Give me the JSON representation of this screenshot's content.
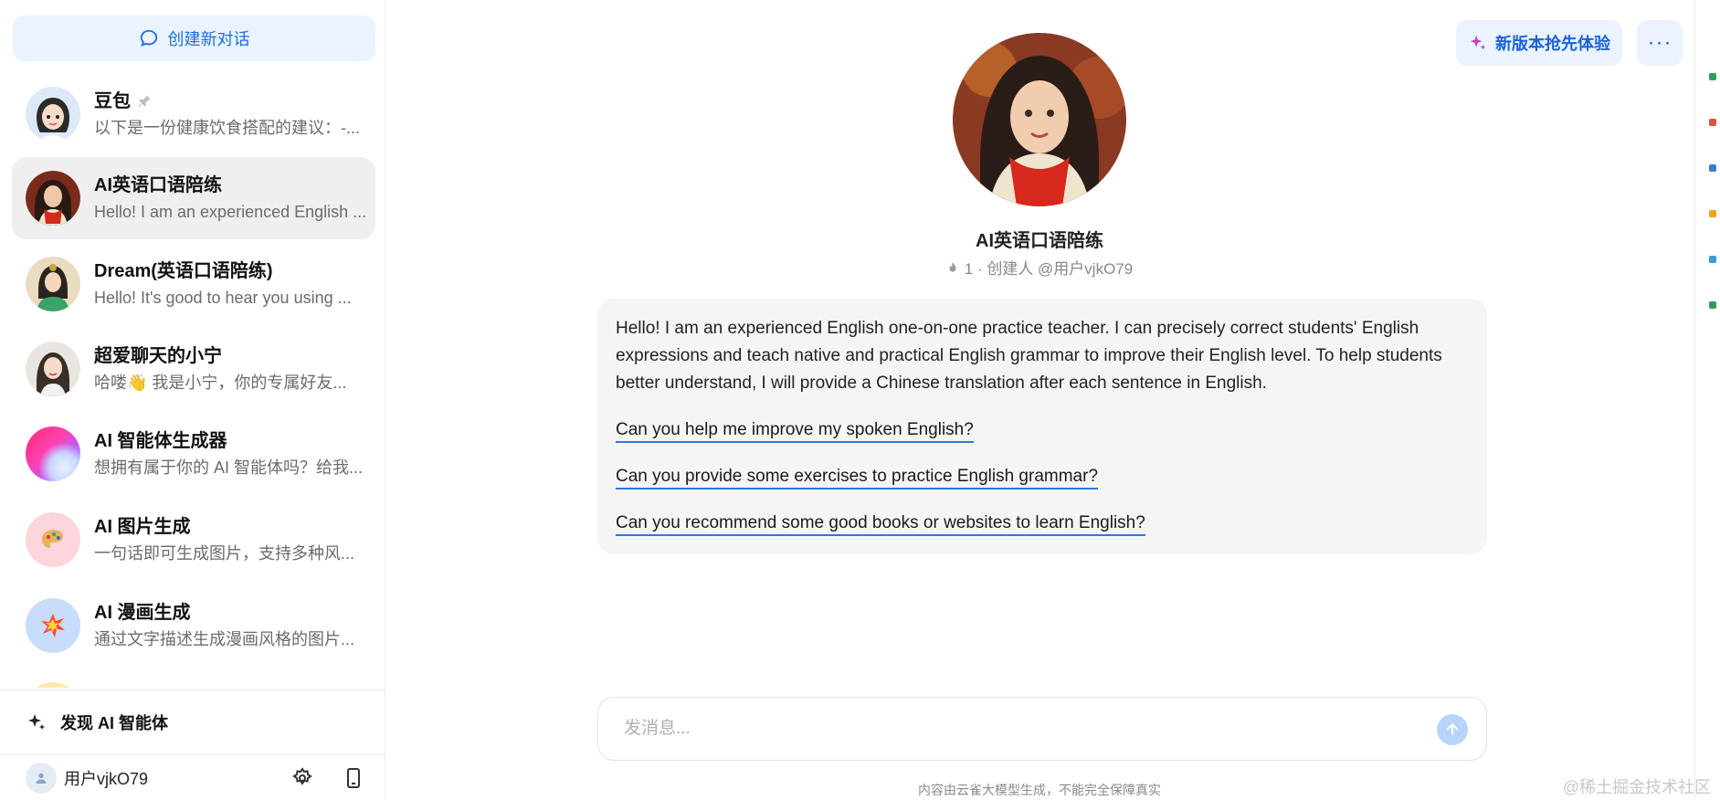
{
  "sidebar": {
    "new_chat_label": "创建新对话",
    "chats": [
      {
        "title": "豆包",
        "preview": "以下是一份健康饮食搭配的建议：-...",
        "pinned": true,
        "avatar": "cartoon-girl-avatar"
      },
      {
        "title": "AI英语口语陪练",
        "preview": "Hello! I am an experienced English ...",
        "active": true,
        "avatar": "red-scarf-woman-avatar"
      },
      {
        "title": "Dream(英语口语陪练)",
        "preview": "Hello! It's good to hear you using ...",
        "avatar": "green-dress-woman-avatar"
      },
      {
        "title": "超爱聊天的小宁",
        "preview": "哈喽👋 我是小宁，你的专属好友...",
        "avatar": "smiling-girl-avatar"
      },
      {
        "title": "AI 智能体生成器",
        "preview": "想拥有属于你的 AI 智能体吗？给我...",
        "avatar": "gradient-orb-avatar"
      },
      {
        "title": "AI 图片生成",
        "preview": "一句话即可生成图片，支持多种风...",
        "avatar": "palette-avatar"
      },
      {
        "title": "AI 漫画生成",
        "preview": "通过文字描述生成漫画风格的图片...",
        "avatar": "comic-burst-avatar"
      }
    ],
    "discover_label": "发现 AI 智能体",
    "user_name": "用户vjkO79"
  },
  "header": {
    "new_version_label": "新版本抢先体验",
    "more_label": "···"
  },
  "bot": {
    "name": "AI英语口语陪练",
    "meta": "1 · 创建人 @用户vjkO79"
  },
  "intro": {
    "text": "Hello! I am an experienced English one-on-one practice teacher. I can precisely correct students' English expressions and teach native and practical English grammar to improve their English level. To help students better understand, I will provide a Chinese translation after each sentence in English.",
    "suggestions": [
      "Can you help me improve my spoken English?",
      "Can you provide some exercises to practice English grammar?",
      "Can you recommend some good books or websites to learn English?"
    ]
  },
  "composer": {
    "placeholder": "发消息..."
  },
  "footer": {
    "disclaimer": "内容由云雀大模型生成，不能完全保障真实",
    "watermark": "@稀土掘金技术社区"
  },
  "colors": {
    "accent": "#1a63d6",
    "accent_bg": "#eaf3ff",
    "active_item_bg": "#efefef",
    "send_btn": "#b9d4fb"
  }
}
